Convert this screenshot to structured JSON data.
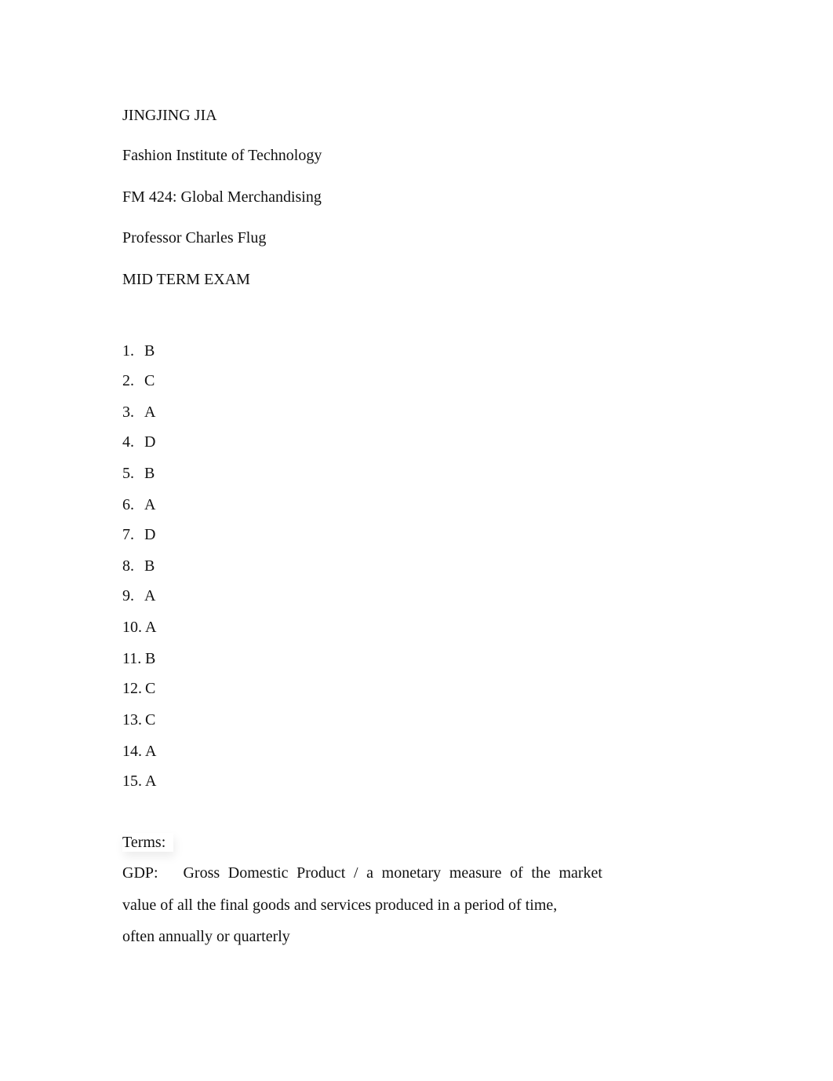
{
  "header": {
    "student_name": "JINGJING JIA",
    "institution": "Fashion Institute of Technology",
    "course": "FM 424: Global Merchandising",
    "professor": "Professor Charles Flug",
    "exam_title": "MID TERM EXAM"
  },
  "answers": [
    {
      "num": "1.",
      "answer": "B"
    },
    {
      "num": "2.",
      "answer": "C"
    },
    {
      "num": "3.",
      "answer": "A"
    },
    {
      "num": "4.",
      "answer": "D"
    },
    {
      "num": "5.",
      "answer": "B"
    },
    {
      "num": "6.",
      "answer": "A"
    },
    {
      "num": "7.",
      "answer": "D"
    },
    {
      "num": "8.",
      "answer": "B"
    },
    {
      "num": "9.",
      "answer": "A"
    },
    {
      "num": "10.",
      "answer": "A"
    },
    {
      "num": "11.",
      "answer": "B"
    },
    {
      "num": "12.",
      "answer": "C"
    },
    {
      "num": "13.",
      "answer": "C"
    },
    {
      "num": "14.",
      "answer": "A"
    },
    {
      "num": "15.",
      "answer": "A"
    }
  ],
  "terms": {
    "label": "Terms:",
    "gdp": {
      "line1": "GDP:   Gross Domestic Product / a monetary measure of the market",
      "line2": "value of all the final goods and services produced in a period of time,",
      "line3": "often annually or quarterly"
    }
  }
}
